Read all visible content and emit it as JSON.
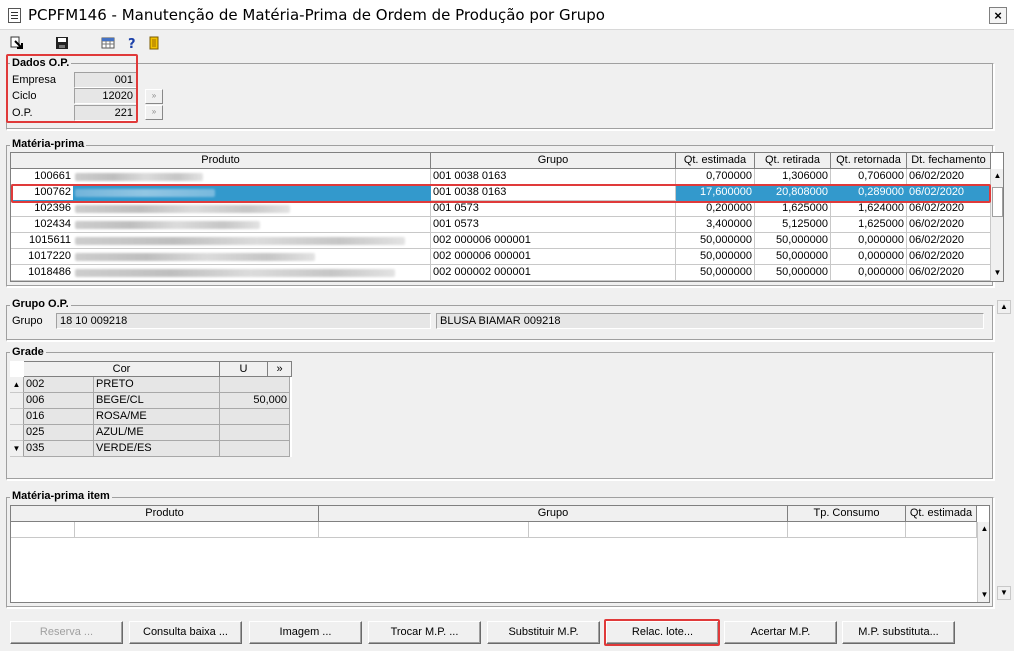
{
  "window": {
    "title": "PCPFM146 - Manutenção de Matéria-Prima de Ordem de Produção por Grupo",
    "close_glyph": "×"
  },
  "toolbar": {
    "icons": [
      "exit-arrow-icon",
      "save-icon",
      "calendar-grid-icon",
      "help-icon",
      "door-exit-icon"
    ]
  },
  "dados_op": {
    "title": "Dados O.P.",
    "empresa_label": "Empresa",
    "empresa_value": "001",
    "ciclo_label": "Ciclo",
    "ciclo_value": "12020",
    "op_label": "O.P.",
    "op_value": "221",
    "lookup_glyph": "»"
  },
  "materia_prima": {
    "title": "Matéria-prima",
    "columns": [
      "Produto",
      "Grupo",
      "Qt. estimada",
      "Qt. retirada",
      "Qt. retornada",
      "Dt. fechamento"
    ],
    "rows": [
      {
        "codigo": "100661",
        "grupo": "001 0038 0163",
        "qt_estimada": "0,700000",
        "qt_retirada": "1,306000",
        "qt_retornada": "0,706000",
        "dt_fechamento": "06/02/2020"
      },
      {
        "codigo": "100762",
        "grupo": "001 0038 0163",
        "qt_estimada": "17,600000",
        "qt_retirada": "20,808000",
        "qt_retornada": "0,289000",
        "dt_fechamento": "06/02/2020"
      },
      {
        "codigo": "102396",
        "grupo": "001 0573",
        "qt_estimada": "0,200000",
        "qt_retirada": "1,625000",
        "qt_retornada": "1,624000",
        "dt_fechamento": "06/02/2020"
      },
      {
        "codigo": "102434",
        "grupo": "001 0573",
        "qt_estimada": "3,400000",
        "qt_retirada": "5,125000",
        "qt_retornada": "1,625000",
        "dt_fechamento": "06/02/2020"
      },
      {
        "codigo": "1015611",
        "grupo": "002 000006 000001",
        "qt_estimada": "50,000000",
        "qt_retirada": "50,000000",
        "qt_retornada": "0,000000",
        "dt_fechamento": "06/02/2020"
      },
      {
        "codigo": "1017220",
        "grupo": "002 000006 000001",
        "qt_estimada": "50,000000",
        "qt_retirada": "50,000000",
        "qt_retornada": "0,000000",
        "dt_fechamento": "06/02/2020"
      },
      {
        "codigo": "1018486",
        "grupo": "002 000002 000001",
        "qt_estimada": "50,000000",
        "qt_retirada": "50,000000",
        "qt_retornada": "0,000000",
        "dt_fechamento": "06/02/2020"
      }
    ]
  },
  "grupo_op": {
    "title": "Grupo O.P.",
    "grupo_label": "Grupo",
    "grupo_value": "18 10 009218",
    "descricao": "BLUSA BIAMAR 009218"
  },
  "grade": {
    "title": "Grade",
    "columns": [
      "Cor",
      "U",
      "»"
    ],
    "rows": [
      {
        "codigo": "002",
        "cor": "PRETO",
        "u": ""
      },
      {
        "codigo": "006",
        "cor": "BEGE/CL",
        "u": "50,000"
      },
      {
        "codigo": "016",
        "cor": "ROSA/ME",
        "u": ""
      },
      {
        "codigo": "025",
        "cor": "AZUL/ME",
        "u": ""
      },
      {
        "codigo": "035",
        "cor": "VERDE/ES",
        "u": ""
      }
    ]
  },
  "materia_prima_item": {
    "title": "Matéria-prima item",
    "columns": [
      "Produto",
      "Grupo",
      "Tp. Consumo",
      "Qt. estimada"
    ]
  },
  "buttons": [
    "Reserva ...",
    "Consulta baixa ...",
    "Imagem ...",
    "Trocar M.P. ...",
    "Substituir M.P.",
    "Relac. lote...",
    "Acertar M.P.",
    "M.P. substituta..."
  ],
  "colors": {
    "selection": "#3399cc",
    "highlight": "#e03a3a"
  }
}
